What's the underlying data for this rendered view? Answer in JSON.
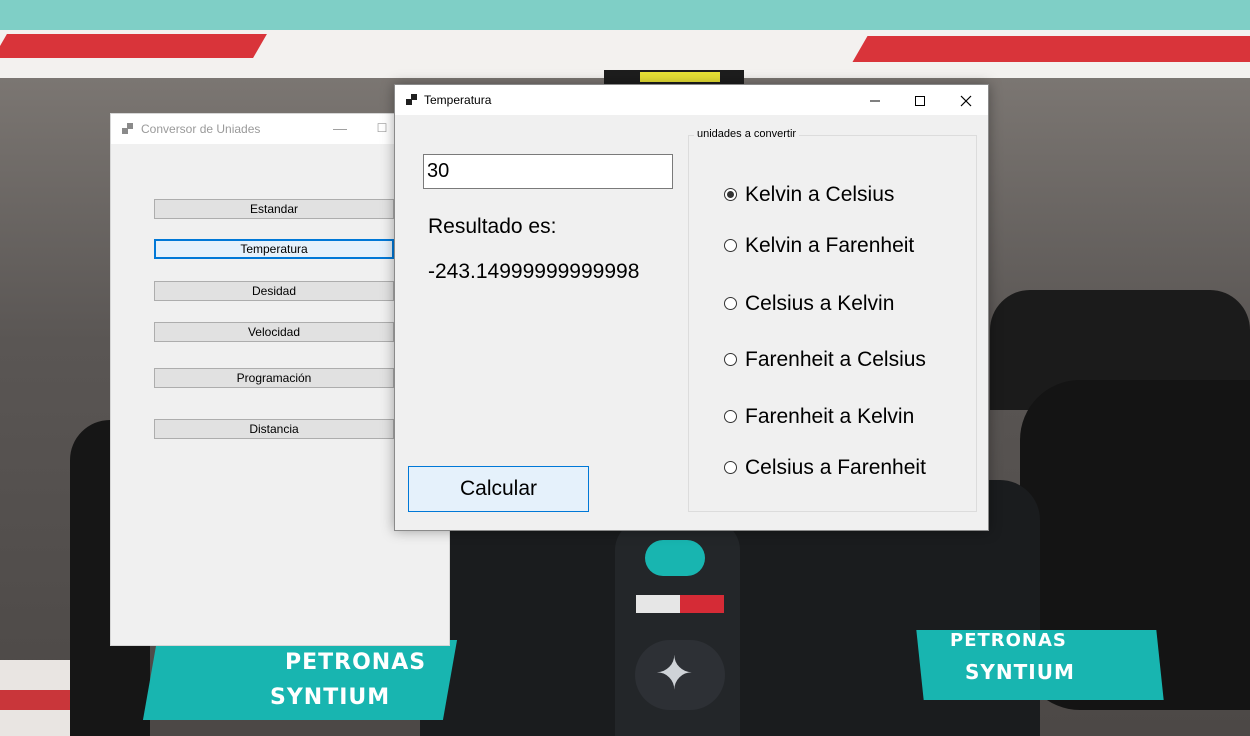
{
  "back_window": {
    "title": "Conversor de Uniades",
    "buttons": [
      "Estandar",
      "Temperatura",
      "Desidad",
      "Velocidad",
      "Programación",
      "Distancia"
    ],
    "focused_button": "Temperatura"
  },
  "front_window": {
    "title": "Temperatura",
    "input_value": "30",
    "result_label": "Resultado es:",
    "result_value": "-243.14999999999998",
    "calculate_label": "Calcular",
    "group_title": "unidades a convertir",
    "options": [
      {
        "label": "Kelvin a Celsius",
        "checked": true
      },
      {
        "label": "Kelvin a Farenheit",
        "checked": false
      },
      {
        "label": "Celsius a Kelvin",
        "checked": false
      },
      {
        "label": "Farenheit a Celsius",
        "checked": false
      },
      {
        "label": "Farenheit a Kelvin",
        "checked": false
      },
      {
        "label": "Celsius a Farenheit",
        "checked": false
      }
    ]
  },
  "background": {
    "sponsor_text_1": "PETRONAS",
    "sponsor_text_2": "SYNTIUM"
  },
  "colors": {
    "accent": "#0078d7",
    "window_bg": "#f0f0f0",
    "teal": "#18b5b0"
  }
}
